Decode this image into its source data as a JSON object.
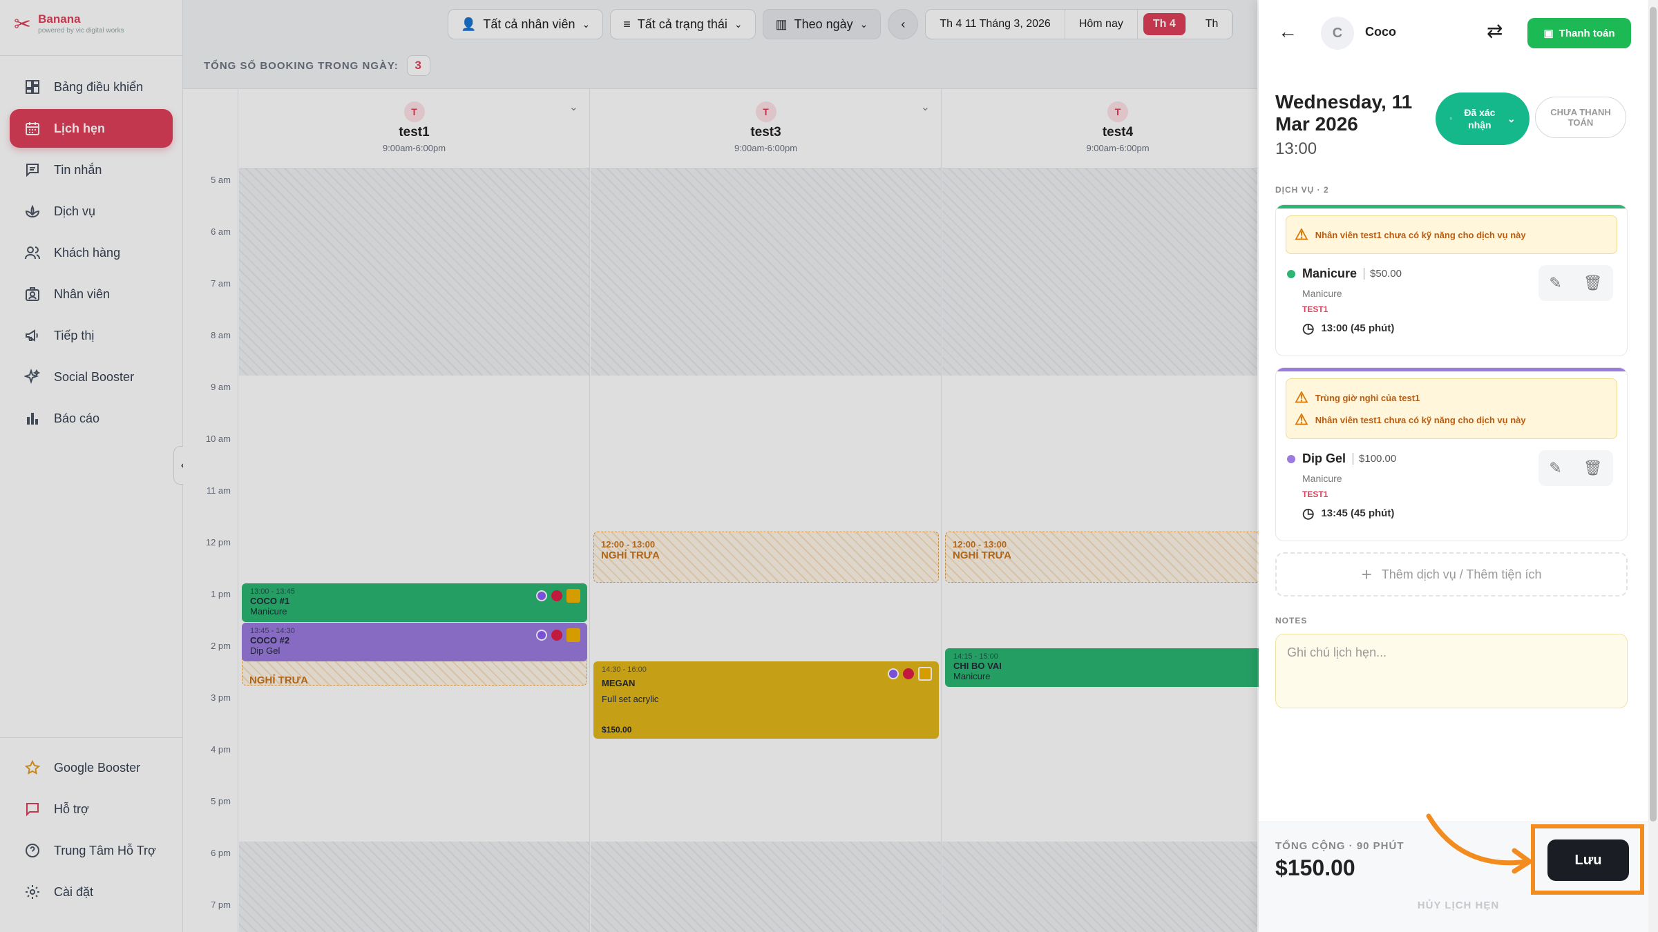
{
  "app": {
    "name": "Banana",
    "tagline": "powered by vic digital works"
  },
  "sidebar": {
    "items": [
      {
        "label": "Bảng điều khiển",
        "icon": "dashboard-icon"
      },
      {
        "label": "Lịch hẹn",
        "icon": "calendar-icon",
        "active": true
      },
      {
        "label": "Tin nhắn",
        "icon": "message-icon"
      },
      {
        "label": "Dịch vụ",
        "icon": "lotus-icon"
      },
      {
        "label": "Khách hàng",
        "icon": "users-icon"
      },
      {
        "label": "Nhân viên",
        "icon": "staff-icon"
      },
      {
        "label": "Tiếp thị",
        "icon": "megaphone-icon"
      },
      {
        "label": "Social Booster",
        "icon": "sparkle-icon"
      },
      {
        "label": "Báo cáo",
        "icon": "bar-chart-icon"
      }
    ],
    "bottom_items": [
      {
        "label": "Google Booster",
        "icon": "star-icon"
      },
      {
        "label": "Hỗ trợ",
        "icon": "chat-icon"
      },
      {
        "label": "Trung Tâm Hỗ Trợ",
        "icon": "help-icon"
      },
      {
        "label": "Cài đặt",
        "icon": "gear-icon"
      }
    ]
  },
  "toolbar": {
    "staff_filter": "Tất cả nhân viên",
    "status_filter": "Tất cả trạng thái",
    "view_mode": "Theo ngày",
    "date_label": "Th 4 11 Tháng 3, 2026",
    "today": "Hôm nay",
    "day_active": "Th 4",
    "day_next": "Th"
  },
  "summary": {
    "label": "TỔNG SỐ BOOKING TRONG NGÀY:",
    "count": "3"
  },
  "time_labels": [
    "5 am",
    "6 am",
    "7 am",
    "8 am",
    "9 am",
    "10 am",
    "11 am",
    "12 pm",
    "1 pm",
    "2 pm",
    "3 pm",
    "4 pm",
    "5 pm",
    "6 pm",
    "7 pm"
  ],
  "staff": [
    {
      "initial": "T",
      "name": "test1",
      "hours": "9:00am-6:00pm"
    },
    {
      "initial": "T",
      "name": "test3",
      "hours": "9:00am-6:00pm"
    },
    {
      "initial": "T",
      "name": "test4",
      "hours": "9:00am-6:00pm"
    }
  ],
  "breaks": [
    {
      "time": "12:00 - 13:00",
      "label": "NGHỈ TRƯA"
    },
    {
      "time": "12:00 - 13:00",
      "label": "NGHỈ TRƯA"
    },
    {
      "label": "NGHỈ TRƯA"
    }
  ],
  "appointments": [
    {
      "time": "13:00 - 13:45",
      "name": "COCO #1",
      "service": "Manicure",
      "color": "#2bb673"
    },
    {
      "time": "13:45 - 14:30",
      "name": "COCO #2",
      "service": "Dip Gel",
      "color": "#9b7be0"
    },
    {
      "time": "14:30 - 16:00",
      "name": "MEGAN",
      "service": "Full set acrylic",
      "price": "$150.00",
      "color": "#e3b719"
    },
    {
      "time": "14:15 - 15:00",
      "name": "CHI BO VAI",
      "service": "Manicure",
      "color": "#2bb673"
    }
  ],
  "panel": {
    "customer_initial": "C",
    "customer_name": "Coco",
    "pay_button": "Thanh toán",
    "date": "Wednesday, 11 Mar 2026",
    "time": "13:00",
    "status": "Đã xác nhận",
    "payment_status": "CHƯA THANH TOÁN",
    "services_label": "DỊCH VỤ · 2",
    "services": [
      {
        "warnings": [
          "Nhân viên test1 chưa có kỹ năng cho dịch vụ này"
        ],
        "name": "Manicure",
        "price": "$50.00",
        "category": "Manicure",
        "staff": "TEST1",
        "time": "13:00 (45 phút)",
        "color": "#2bb673"
      },
      {
        "warnings": [
          "Trùng giờ nghỉ của test1",
          "Nhân viên test1 chưa có kỹ năng cho dịch vụ này"
        ],
        "name": "Dip Gel",
        "price": "$100.00",
        "category": "Manicure",
        "staff": "TEST1",
        "time": "13:45 (45 phút)",
        "color": "#9b7be0"
      }
    ],
    "add_service": "Thêm dịch vụ / Thêm tiện ích",
    "notes_label": "NOTES",
    "notes_placeholder": "Ghi chú lịch hẹn...",
    "total_label": "TỔNG CỘNG · 90 PHÚT",
    "total_value": "$150.00",
    "save": "Lưu",
    "cancel": "HỦY LỊCH HẸN"
  }
}
